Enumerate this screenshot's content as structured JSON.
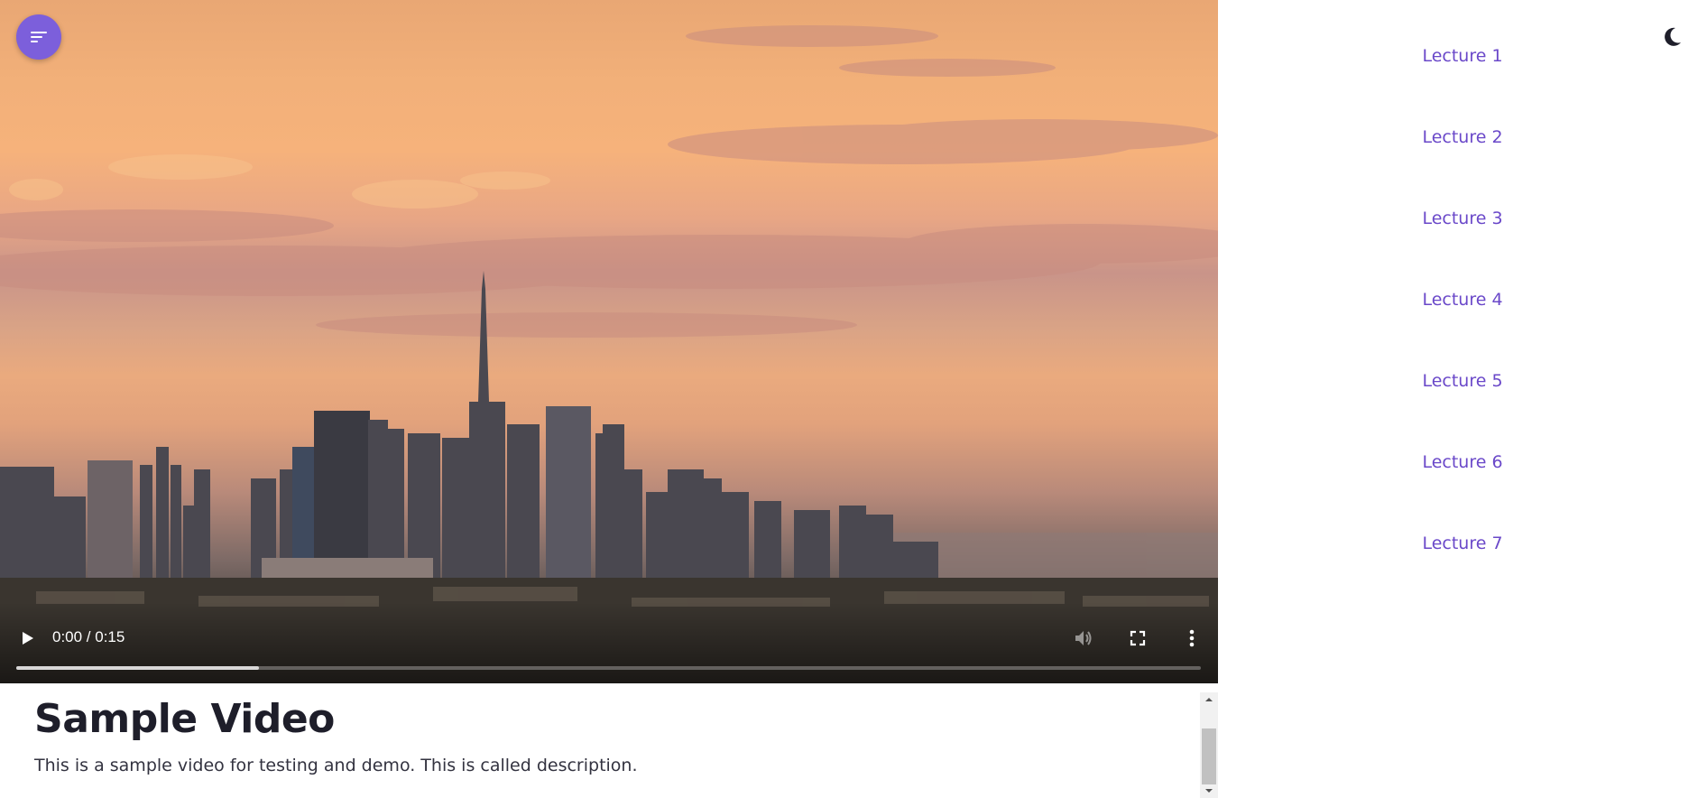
{
  "player": {
    "time_display": "0:00 / 0:15",
    "progress_fraction": 0.0,
    "buffered_fraction": 0.205,
    "controls": {
      "play_icon": "play-icon",
      "volume_icon": "volume-icon",
      "fullscreen_icon": "fullscreen-icon",
      "more_icon": "more-vert-icon"
    }
  },
  "menu_button": {
    "icon": "menu-lines-icon",
    "color": "#7c5fdb"
  },
  "video_info": {
    "title": "Sample Video",
    "description": "This is a sample video for testing and demo. This is called description."
  },
  "theme_toggle": {
    "icon": "moon-icon"
  },
  "sidebar": {
    "lectures": [
      {
        "label": "Lecture 1"
      },
      {
        "label": "Lecture 2"
      },
      {
        "label": "Lecture 3"
      },
      {
        "label": "Lecture 4"
      },
      {
        "label": "Lecture 5"
      },
      {
        "label": "Lecture 6"
      },
      {
        "label": "Lecture 7"
      }
    ]
  },
  "colors": {
    "accent": "#7c5fdb",
    "lecture_link": "#6a48c9",
    "title_text": "#1e1e2a"
  }
}
